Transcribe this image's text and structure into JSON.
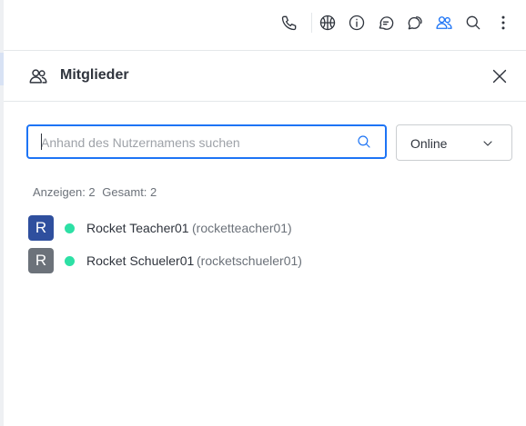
{
  "toolbar": {
    "icons": [
      "phone-icon",
      "discussion-icon",
      "info-icon",
      "threads-icon",
      "chat-bubbles-icon",
      "members-icon",
      "search-icon",
      "kebab-menu-icon"
    ]
  },
  "panel": {
    "title": "Mitglieder"
  },
  "search": {
    "placeholder": "Anhand des Nutzernamens suchen",
    "value": ""
  },
  "filter": {
    "selected": "Online"
  },
  "counts": {
    "showing": "Anzeigen: 2",
    "total": "Gesamt: 2"
  },
  "members": [
    {
      "initial": "R",
      "name": "Rocket Teacher01",
      "username": "(rocketteacher01)",
      "avatar_color": "#2f4f9e",
      "status": "online",
      "status_color": "#2de0a5"
    },
    {
      "initial": "R",
      "name": "Rocket Schueler01",
      "username": "(rocketschueler01)",
      "avatar_color": "#6c727a",
      "status": "online",
      "status_color": "#2de0a5"
    }
  ],
  "colors": {
    "accent": "#1d74f5",
    "online": "#2de0a5"
  }
}
